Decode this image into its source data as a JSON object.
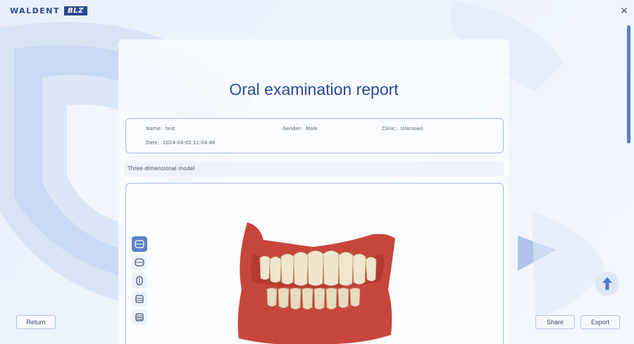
{
  "brand": {
    "name": "WALDENT",
    "badge": "BLZ"
  },
  "report": {
    "title": "Oral examination report",
    "fields": {
      "name_label": "Name:",
      "name_value": "test",
      "gender_label": "Gender:",
      "gender_value": "Male",
      "clinic_label": "Clinic:",
      "clinic_value": "Unknown",
      "date_label": "Date:",
      "date_value": "2024-04-02 11:04:46"
    },
    "section_label": "Three-dimensional model"
  },
  "buttons": {
    "return_label": "Return",
    "share_label": "Share",
    "export_label": "Export"
  },
  "icons": {
    "close": "close-icon",
    "scroll_top": "arrow-up-icon",
    "views": [
      "front-view-icon",
      "upper-jaw-icon",
      "side-view-icon",
      "lower-jaw-icon",
      "occlusion-view-icon"
    ]
  },
  "colors": {
    "accent": "#2c4a96",
    "tool_active": "#5b80c8",
    "scroll": "#5b7fc2",
    "gingiva": "#c7463c",
    "teeth": "#efe6cd"
  }
}
